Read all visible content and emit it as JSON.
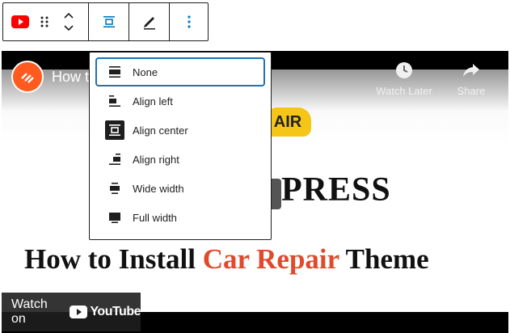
{
  "toolbar": {
    "buttons": [
      {
        "name": "youtube-block-icon"
      },
      {
        "name": "drag-handle-icon"
      },
      {
        "name": "move-up-icon"
      },
      {
        "name": "move-down-icon"
      },
      {
        "name": "align-center-icon"
      },
      {
        "name": "edit-pencil-icon"
      },
      {
        "name": "more-options-icon"
      }
    ],
    "accent_color": "#007cba"
  },
  "video": {
    "title": "How t",
    "watch_later_label": "Watch Later",
    "share_label": "Share",
    "logo_badge_text": "AIR",
    "press_text": "PRESS",
    "headline_part1": "How to Install ",
    "headline_accent": "Car Repair",
    "headline_part2": " Theme",
    "watch_on_label": "Watch on",
    "youtube_word": "YouTube",
    "accent_color": "#e0492a",
    "logo_color": "#ff5a1f"
  },
  "alignment_menu": {
    "items": [
      {
        "label": "None",
        "icon": "align-none-icon",
        "focused": true,
        "selected": false
      },
      {
        "label": "Align left",
        "icon": "align-left-icon",
        "focused": false,
        "selected": false
      },
      {
        "label": "Align center",
        "icon": "align-center-icon",
        "focused": false,
        "selected": true
      },
      {
        "label": "Align right",
        "icon": "align-right-icon",
        "focused": false,
        "selected": false
      },
      {
        "label": "Wide width",
        "icon": "align-wide-icon",
        "focused": false,
        "selected": false
      },
      {
        "label": "Full width",
        "icon": "align-full-icon",
        "focused": false,
        "selected": false
      }
    ],
    "focus_color": "#2271b1"
  }
}
